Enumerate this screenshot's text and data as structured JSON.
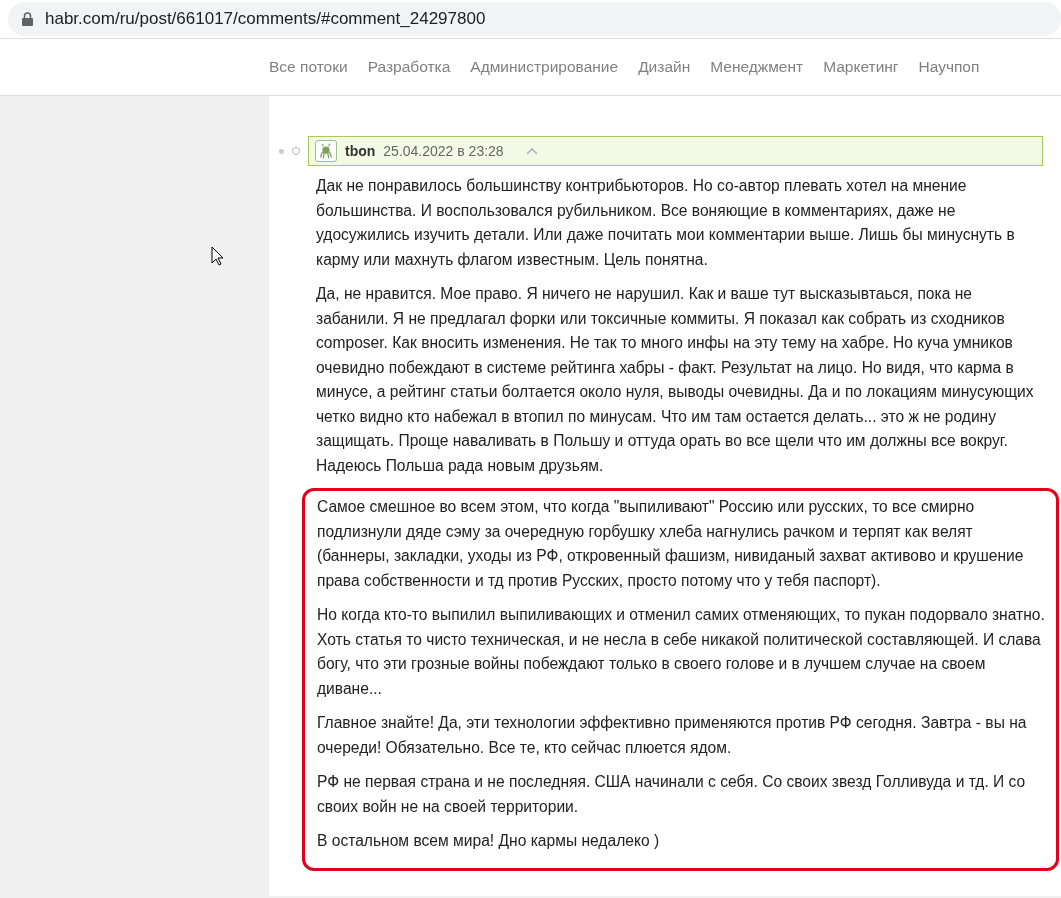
{
  "address_bar": {
    "url": "habr.com/ru/post/661017/comments/#comment_24297800"
  },
  "nav": {
    "items": [
      "Все потоки",
      "Разработка",
      "Администрирование",
      "Дизайн",
      "Менеджмент",
      "Маркетинг",
      "Научпоп"
    ]
  },
  "comment": {
    "author": "tbon",
    "date": "25.04.2022 в 23:28",
    "highlighted": true,
    "paragraphs": [
      {
        "text": "Дак не понравилось большинству контрибьюторов. Но со-автор плевать хотел на мнение большинства. И воспользовался рубильником. Все воняющие в комментариях, даже не удосужились изучить детали. Или даже почитать мои комментарии выше. Лишь бы минуснуть в карму или махнуть флагом известным. Цель понятна.",
        "boxed": false
      },
      {
        "text": "Да, не нравится. Мое право. Я ничего не нарушил. Как и ваше тут высказывтаься, пока не забанили. Я не предлагал форки или токсичные коммиты. Я показал как собрать из сходников composer. Как вносить изменения. Не так то много инфы на эту тему на хабре. Но куча умников очевидно побеждают в системе рейтинга хабры - факт. Результат на лицо. Но видя, что карма в минусе, а рейтинг статьи болтается около нуля, выводы очевидны. Да и по локациям минусующих четко видно кто набежал в втопил по минусам. Что им там остается делать... это ж не родину защищать. Проще наваливать в Польшу и оттуда орать во все щели что им должны все вокруг. Надеюсь Польша рада новым друзьям.",
        "boxed": false
      },
      {
        "text": "Самое смешное во всем этом, что когда \"выпиливают\" Россию или русских, то все смирно подлизнули дяде сэму за очередную горбушку хлеба нагнулись рачком и терпят как велят (баннеры, закладки, уходы из РФ, откровенный фашизм, нивиданый захват активово и крушение права собственности и тд против Русских, просто потому что у тебя паспорт).",
        "boxed": true
      },
      {
        "text": "Но когда кто-то выпилил выпиливающих и отменил самих отменяющих, то пукан подорвало знатно. Хоть статья то чисто техническая, и не несла в себе никакой политической составляющей. И слава богу, что эти грозные войны побеждают только в своего голове и в лучшем случае на своем диване...",
        "boxed": true
      },
      {
        "text": "Главное знайте! Да, эти технологии эффективно применяются против РФ сегодня. Завтра - вы на очереди! Обязательно. Все те, кто сейчас плюется ядом.",
        "boxed": true
      },
      {
        "text": "РФ не первая страна и не последняя. США начинали с себя. Со своих звезд Голливуда и тд. И со своих войн не на своей территории.",
        "boxed": true
      },
      {
        "text": "В остальном всем мира! Дно кармы недалеко )",
        "boxed": true
      }
    ]
  }
}
